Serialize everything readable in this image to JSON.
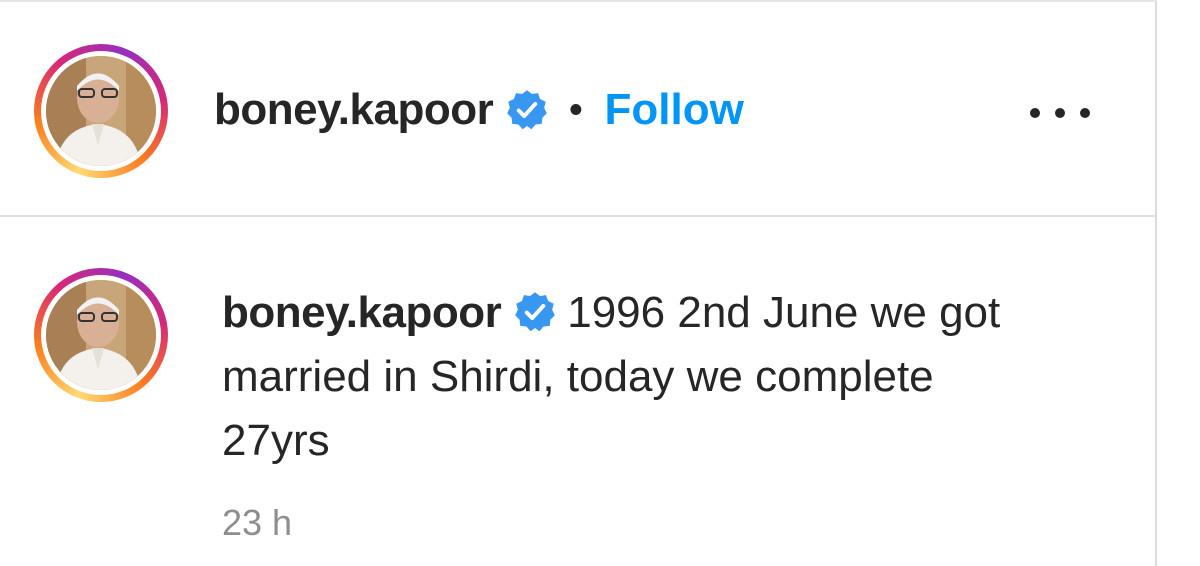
{
  "header": {
    "username": "boney.kapoor",
    "separator": "•",
    "follow_label": "Follow",
    "verified_icon": "verified-badge-icon",
    "more_icon": "more-options-icon"
  },
  "comment": {
    "username": "boney.kapoor",
    "text": "1996 2nd June we got married in Shirdi, today we complete 27yrs",
    "timestamp": "23 h"
  },
  "colors": {
    "follow_blue": "#0095f6",
    "verified_blue": "#3897f0",
    "text_dark": "#262626",
    "text_muted": "#8e8e8e"
  }
}
